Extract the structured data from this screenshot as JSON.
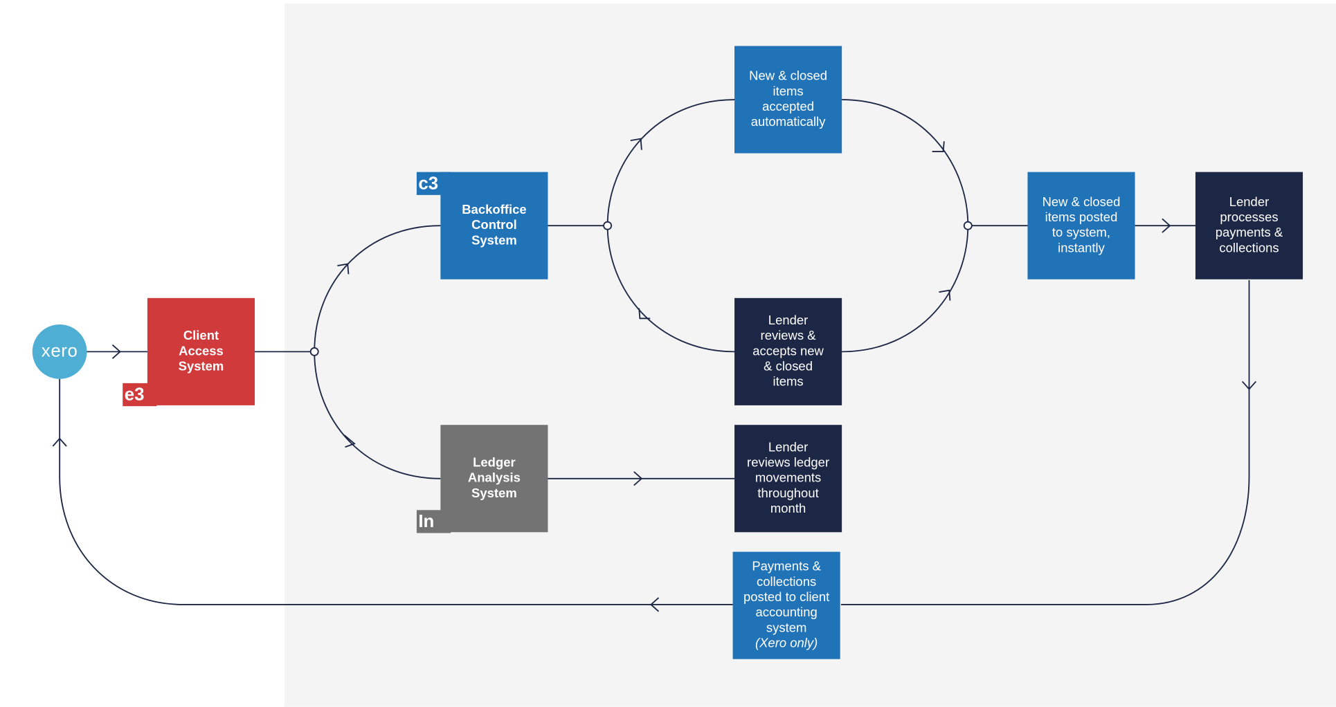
{
  "colors": {
    "client": "#d03a3b",
    "blue": "#2173b7",
    "navy": "#1c2645",
    "gray": "#737373",
    "xero": "#4eaed3",
    "line": "#1c2645",
    "panel": "#f4f4f4"
  },
  "xero": {
    "logo_text": "xero"
  },
  "systems": {
    "client_access": {
      "label": "Client\nAccess\nSystem",
      "tag": "e3"
    },
    "backoffice": {
      "label": "Backoffice\nControl\nSystem",
      "tag": "c3"
    },
    "ledger": {
      "label": "Ledger\nAnalysis\nSystem",
      "tag": "In"
    }
  },
  "steps": {
    "auto_accept": "New & closed\nitems\naccepted\nautomatically",
    "lender_review": "Lender\nreviews &\naccepts new\n& closed\nitems",
    "ledger_review": "Lender\nreviews ledger\nmovements\nthroughout\nmonth",
    "posted": "New & closed\nitems posted\nto system,\ninstantly",
    "lender_processes": "Lender\nprocesses\npayments &\ncollections",
    "payments_posted": "Payments &\ncollections\nposted to client\naccounting\nsystem",
    "payments_note": "(Xero only)"
  }
}
